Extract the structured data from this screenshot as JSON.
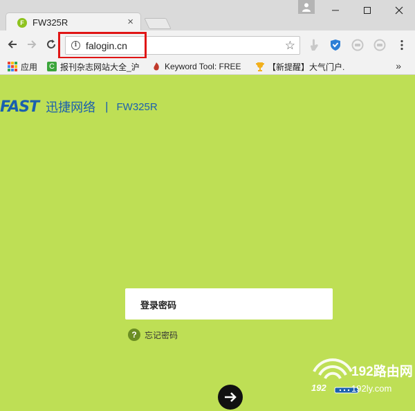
{
  "browser": {
    "tab_title": "FW325R",
    "tab_favicon_letter": "F",
    "url": "falogin.cn",
    "highlight_color": "#e01515",
    "bookmarks": [
      {
        "label": "应用",
        "icon": "apps-grid-icon"
      },
      {
        "label": "报刊杂志网站大全_沪",
        "icon": "green-refresh-icon"
      },
      {
        "label": "Keyword Tool: FREE",
        "icon": "flame-icon"
      },
      {
        "label": "【新提醒】大气门户.",
        "icon": "trophy-icon"
      }
    ],
    "more_bookmarks": "»"
  },
  "page": {
    "background": "#bedf55",
    "logo": {
      "brand": "FAST",
      "brand_cn": "迅捷网络",
      "separator": "|",
      "model": "FW325R"
    },
    "password_label": "登录密码",
    "forgot_icon_text": "?",
    "forgot_password": "忘记密码",
    "watermark": {
      "title": "192路由网",
      "number": "192",
      "url": "192ly.com"
    }
  }
}
